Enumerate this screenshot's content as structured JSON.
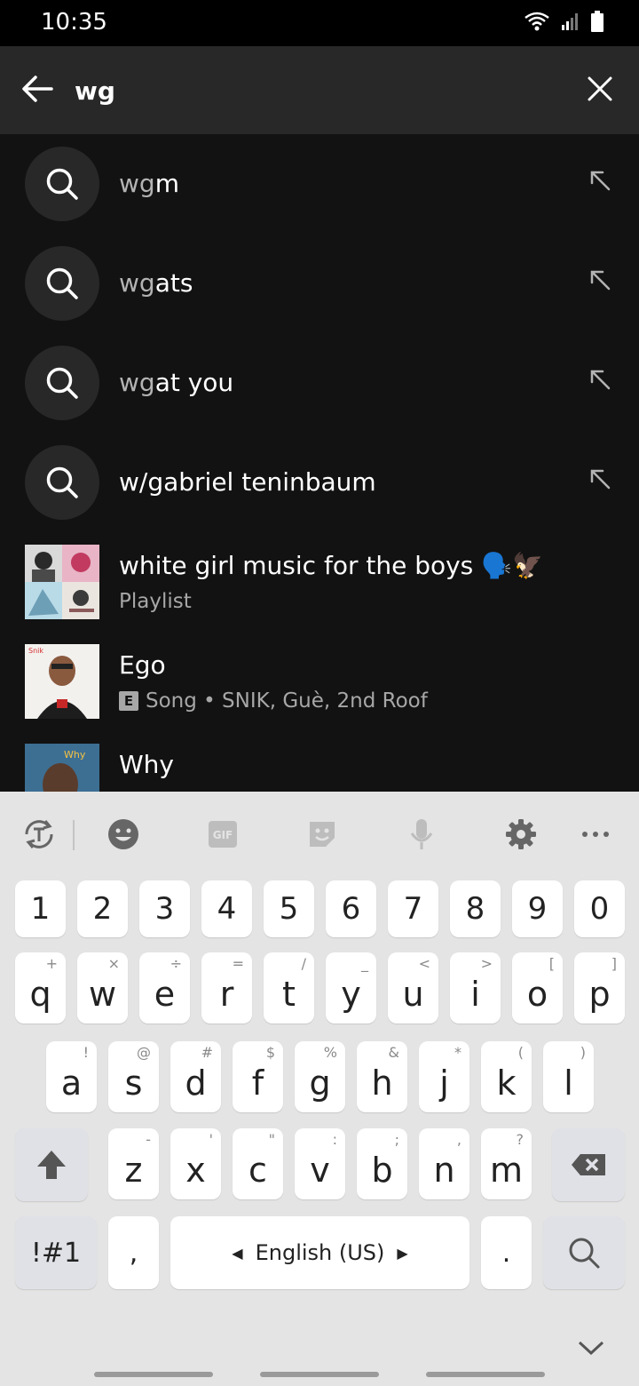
{
  "status_bar": {
    "time": "10:35"
  },
  "search": {
    "query": "wg"
  },
  "suggestions": [
    {
      "typed": "wg",
      "rest": "m"
    },
    {
      "typed": "wg",
      "rest": "ats"
    },
    {
      "typed": "wg",
      "rest": "at you"
    },
    {
      "typed": "",
      "rest": "w/gabriel teninbaum"
    }
  ],
  "results": [
    {
      "title": "white girl music for the boys 🗣️🦅",
      "subtitle": "Playlist",
      "explicit": false
    },
    {
      "title": "Ego",
      "subtitle": "Song • SNIK, Guè, 2nd Roof",
      "explicit": true,
      "explicit_label": "E"
    },
    {
      "title": "Why",
      "subtitle": "",
      "explicit": false
    }
  ],
  "keyboard": {
    "numbers": [
      "1",
      "2",
      "3",
      "4",
      "5",
      "6",
      "7",
      "8",
      "9",
      "0"
    ],
    "row1": [
      [
        "q",
        "+"
      ],
      [
        "w",
        "×"
      ],
      [
        "e",
        "÷"
      ],
      [
        "r",
        "="
      ],
      [
        "t",
        "/"
      ],
      [
        "y",
        "_"
      ],
      [
        "u",
        "<"
      ],
      [
        "i",
        ">"
      ],
      [
        "o",
        "["
      ],
      [
        "p",
        "]"
      ]
    ],
    "row2": [
      [
        "a",
        "!"
      ],
      [
        "s",
        "@"
      ],
      [
        "d",
        "#"
      ],
      [
        "f",
        "$"
      ],
      [
        "g",
        "%"
      ],
      [
        "h",
        "&"
      ],
      [
        "j",
        "*"
      ],
      [
        "k",
        "("
      ],
      [
        "l",
        ")"
      ]
    ],
    "row3": [
      [
        "z",
        "-"
      ],
      [
        "x",
        "'"
      ],
      [
        "c",
        "\""
      ],
      [
        "v",
        ":"
      ],
      [
        "b",
        ";"
      ],
      [
        "n",
        ","
      ],
      [
        "m",
        "?"
      ]
    ],
    "symbols_key": "!#1",
    "comma_key": ",",
    "space_label": "English (US)",
    "period_key": "."
  },
  "colors": {
    "background": "#121212",
    "header": "#282828",
    "keyboard": "#e4e4e4"
  }
}
